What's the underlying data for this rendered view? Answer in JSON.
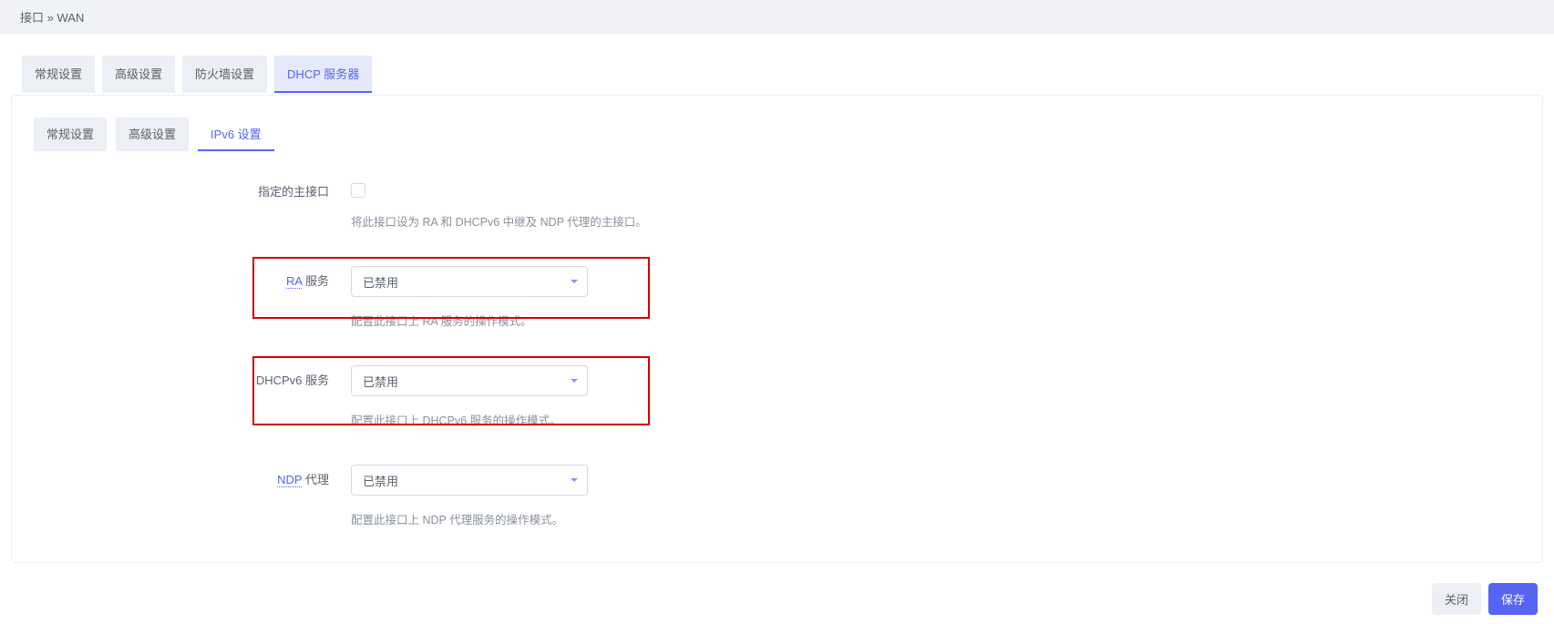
{
  "breadcrumb": {
    "part1": "接口",
    "sep": " » ",
    "part2": "WAN"
  },
  "outer_tabs": [
    {
      "label": "常规设置",
      "active": false
    },
    {
      "label": "高级设置",
      "active": false
    },
    {
      "label": "防火墙设置",
      "active": false
    },
    {
      "label": "DHCP 服务器",
      "active": true
    }
  ],
  "inner_tabs": [
    {
      "label": "常规设置",
      "active": false
    },
    {
      "label": "高级设置",
      "active": false
    },
    {
      "label": "IPv6 设置",
      "active": true
    }
  ],
  "fields": {
    "master_if": {
      "label": "指定的主接口",
      "help": "将此接口设为 RA 和 DHCPv6 中继及 NDP 代理的主接口。"
    },
    "ra": {
      "link": "RA",
      "suffix": " 服务",
      "value": "已禁用",
      "help": "配置此接口上 RA 服务的操作模式。"
    },
    "dhcpv6": {
      "label": "DHCPv6 服务",
      "value": "已禁用",
      "help": "配置此接口上 DHCPv6 服务的操作模式。"
    },
    "ndp": {
      "link": "NDP",
      "suffix": " 代理",
      "value": "已禁用",
      "help": "配置此接口上 NDP 代理服务的操作模式。"
    }
  },
  "buttons": {
    "close": "关闭",
    "save": "保存"
  }
}
